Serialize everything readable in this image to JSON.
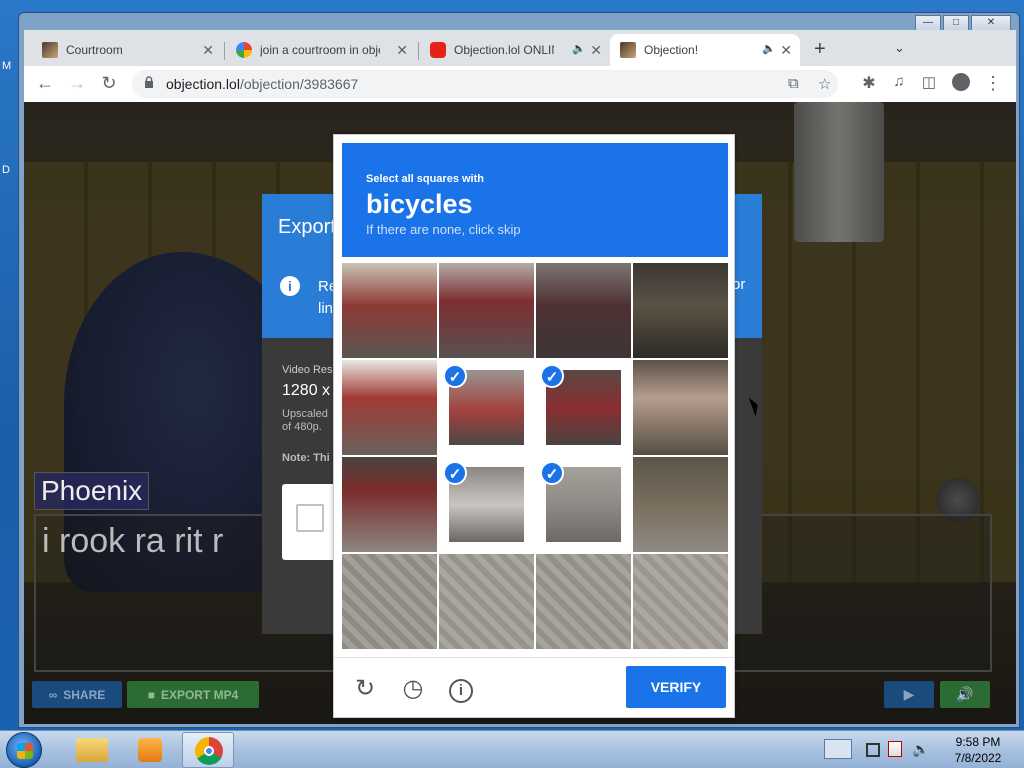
{
  "desktop": {
    "left_letters": [
      "M",
      "D"
    ]
  },
  "browser": {
    "tabs": [
      {
        "title": "Courtroom",
        "favicon": "courtroom-favicon-icon"
      },
      {
        "title": "join a courtroom in obje",
        "favicon": "google-favicon-icon"
      },
      {
        "title": "Objection.lol ONLIN",
        "favicon": "youtube-favicon-icon"
      },
      {
        "title": "Objection!",
        "favicon": "courtroom-favicon-icon",
        "active": true
      }
    ],
    "url_host": "objection.lol",
    "url_path": "/objection/3983667"
  },
  "page": {
    "name_tag": "Phoenix",
    "dialog_text": "i rook ra rit r",
    "share_label": "SHARE",
    "export_label": "EXPORT MP4"
  },
  "export_modal": {
    "title": "Export",
    "info_text_1": "Re",
    "info_text_2": "lin",
    "info_text_right": "or",
    "resolution_label": "Video Res",
    "resolution_value": "1280 x",
    "upscale_note_1": "Upscaled",
    "upscale_note_2": "of 480p.",
    "note": "Note: Thi"
  },
  "captcha": {
    "instruction": "Select all squares with",
    "object": "bicycles",
    "skip_hint": "If there are none, click skip",
    "selected_tiles": [
      5,
      6,
      9,
      10
    ],
    "verify_label": "VERIFY"
  },
  "taskbar": {
    "time": "9:58 PM",
    "date": "7/8/2022"
  }
}
